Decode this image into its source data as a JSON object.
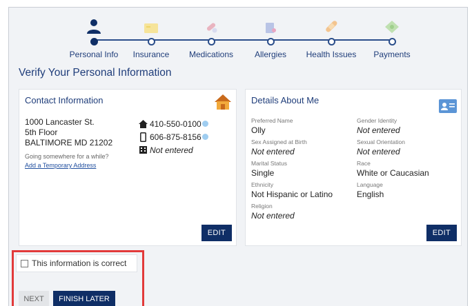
{
  "steps": [
    {
      "label": "Personal Info",
      "icon": "person-icon",
      "active": true
    },
    {
      "label": "Insurance",
      "icon": "insurance-card-icon",
      "active": false
    },
    {
      "label": "Medications",
      "icon": "pills-icon",
      "active": false
    },
    {
      "label": "Allergies",
      "icon": "allergy-icon",
      "active": false
    },
    {
      "label": "Health Issues",
      "icon": "bandage-icon",
      "active": false
    },
    {
      "label": "Payments",
      "icon": "money-icon",
      "active": false
    }
  ],
  "page_title": "Verify Your Personal Information",
  "contact": {
    "title": "Contact Information",
    "address": [
      "1000 Lancaster St.",
      "5th Floor",
      "BALTIMORE MD 21202"
    ],
    "going_somewhere": "Going somewhere for a while?",
    "temp_link": "Add a Temporary Address",
    "home_phone": "410-550-0100",
    "mobile_phone": "606-875-8156",
    "work_phone": "Not entered",
    "edit_label": "EDIT"
  },
  "details": {
    "title": "Details About Me",
    "left": [
      {
        "label": "Preferred Name",
        "value": "Olly",
        "italic": false
      },
      {
        "label": "Sex Assigned at Birth",
        "value": "Not entered",
        "italic": true
      },
      {
        "label": "Marital Status",
        "value": "Single",
        "italic": false
      },
      {
        "label": "Ethnicity",
        "value": "Not Hispanic or Latino",
        "italic": false
      },
      {
        "label": "Religion",
        "value": "Not entered",
        "italic": true
      }
    ],
    "right": [
      {
        "label": "Gender Identity",
        "value": "Not entered",
        "italic": true
      },
      {
        "label": "Sexual Orientation",
        "value": "Not entered",
        "italic": true
      },
      {
        "label": "Race",
        "value": "White or Caucasian",
        "italic": false
      },
      {
        "label": "Language",
        "value": "English",
        "italic": false
      }
    ],
    "edit_label": "EDIT"
  },
  "confirm_label": "This information is correct",
  "buttons": {
    "next": "NEXT",
    "finish_later": "FINISH LATER"
  },
  "colors": {
    "primary": "#0f2e66",
    "link": "#1f3d7a",
    "highlight": "#e23a3a"
  }
}
